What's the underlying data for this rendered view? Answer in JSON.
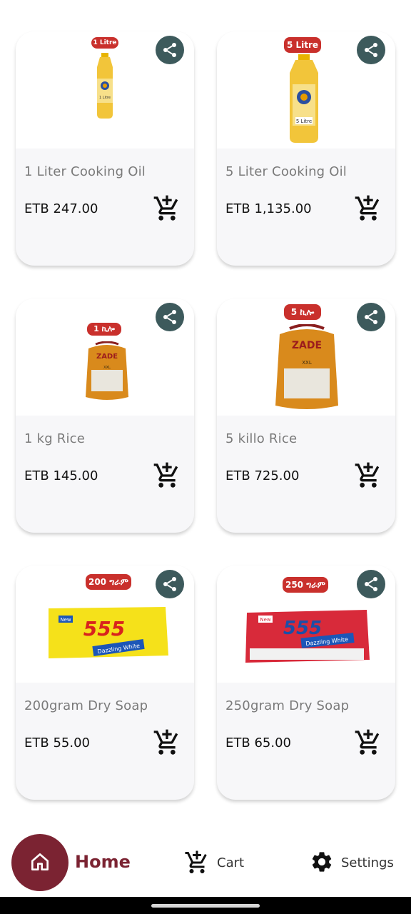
{
  "products": [
    {
      "title": "1 Liter Cooking Oil",
      "price": "ETB 247.00",
      "badge": "1 Litre",
      "image": "oil-bottle-small",
      "bottle_label": "1 Litre"
    },
    {
      "title": "5 Liter Cooking Oil",
      "price": "ETB 1,135.00",
      "badge": "5 Litre",
      "image": "oil-bottle-large",
      "bottle_label": "5 Litre"
    },
    {
      "title": "1 kg Rice",
      "price": "ETB 145.00",
      "badge": "1 ኪሎ",
      "image": "rice-bag-small",
      "bag_brand": "ZADE",
      "bag_size": "XXL"
    },
    {
      "title": "5 killo Rice",
      "price": "ETB 725.00",
      "badge": "5 ኪሎ",
      "image": "rice-bag-large",
      "bag_brand": "ZADE",
      "bag_size": "XXL"
    },
    {
      "title": "200gram Dry Soap",
      "price": "ETB 55.00",
      "badge": "200 ግራም",
      "image": "soap-yellow",
      "soap_brand": "555",
      "soap_new": "New",
      "soap_slogan": "Dazzling White"
    },
    {
      "title": "250gram Dry Soap",
      "price": "ETB 65.00",
      "badge": "250 ግራም",
      "image": "soap-red",
      "soap_brand": "555",
      "soap_new": "New",
      "soap_slogan": "Dazzling White"
    }
  ],
  "nav": {
    "home_label": "Home",
    "cart_label": "Cart",
    "settings_label": "Settings"
  },
  "colors": {
    "primary": "#7b2332",
    "badge": "#c9302c",
    "share_button": "#3d5a5c",
    "card_bg": "#f7f7f9"
  },
  "icons": {
    "share": "share-icon",
    "add_to_cart": "add-to-cart-icon",
    "home": "home-icon",
    "cart": "cart-icon",
    "settings": "gear-icon"
  }
}
